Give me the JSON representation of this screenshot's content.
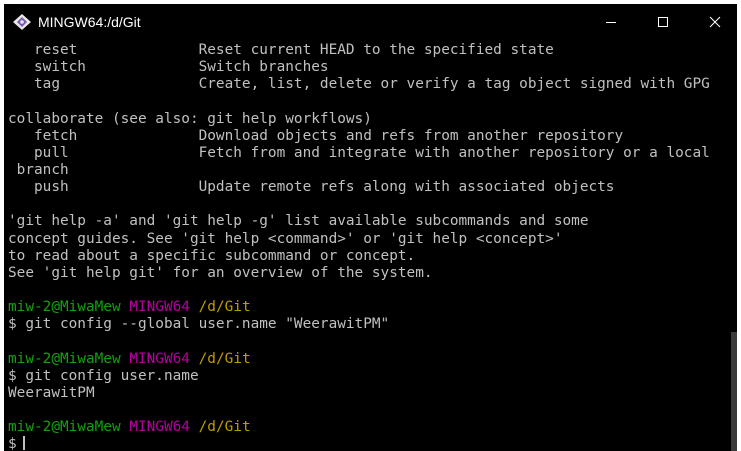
{
  "window": {
    "title": "MINGW64:/d/Git"
  },
  "terminal": {
    "lines": [
      "   reset              Reset current HEAD to the specified state",
      "   switch             Switch branches",
      "   tag                Create, list, delete or verify a tag object signed with GPG",
      "",
      "collaborate (see also: git help workflows)",
      "   fetch              Download objects and refs from another repository",
      "   pull               Fetch from and integrate with another repository or a local",
      " branch",
      "   push               Update remote refs along with associated objects",
      "",
      "'git help -a' and 'git help -g' list available subcommands and some",
      "concept guides. See 'git help <command>' or 'git help <concept>'",
      "to read about a specific subcommand or concept.",
      "See 'git help git' for an overview of the system.",
      ""
    ],
    "prompt_1": {
      "user": "miw-2@MiwaMew",
      "host": "MINGW64",
      "path": "/d/Git"
    },
    "command_1": "$ git config --global user.name \"WeerawitPM\"",
    "prompt_2": {
      "user": "miw-2@MiwaMew",
      "host": "MINGW64",
      "path": "/d/Git"
    },
    "command_2": "$ git config user.name",
    "output_2": "WeerawitPM",
    "prompt_3": {
      "user": "miw-2@MiwaMew",
      "host": "MINGW64",
      "path": "/d/Git"
    },
    "command_3": "$"
  },
  "colors": {
    "background": "#000000",
    "text": "#c0c0c0",
    "prompt_user": "#13a10e",
    "prompt_host": "#b4009e",
    "prompt_path": "#c19c00"
  },
  "icons": {
    "app": "git-bash-icon",
    "minimize": "minimize-icon",
    "maximize": "maximize-icon",
    "close": "close-icon"
  }
}
